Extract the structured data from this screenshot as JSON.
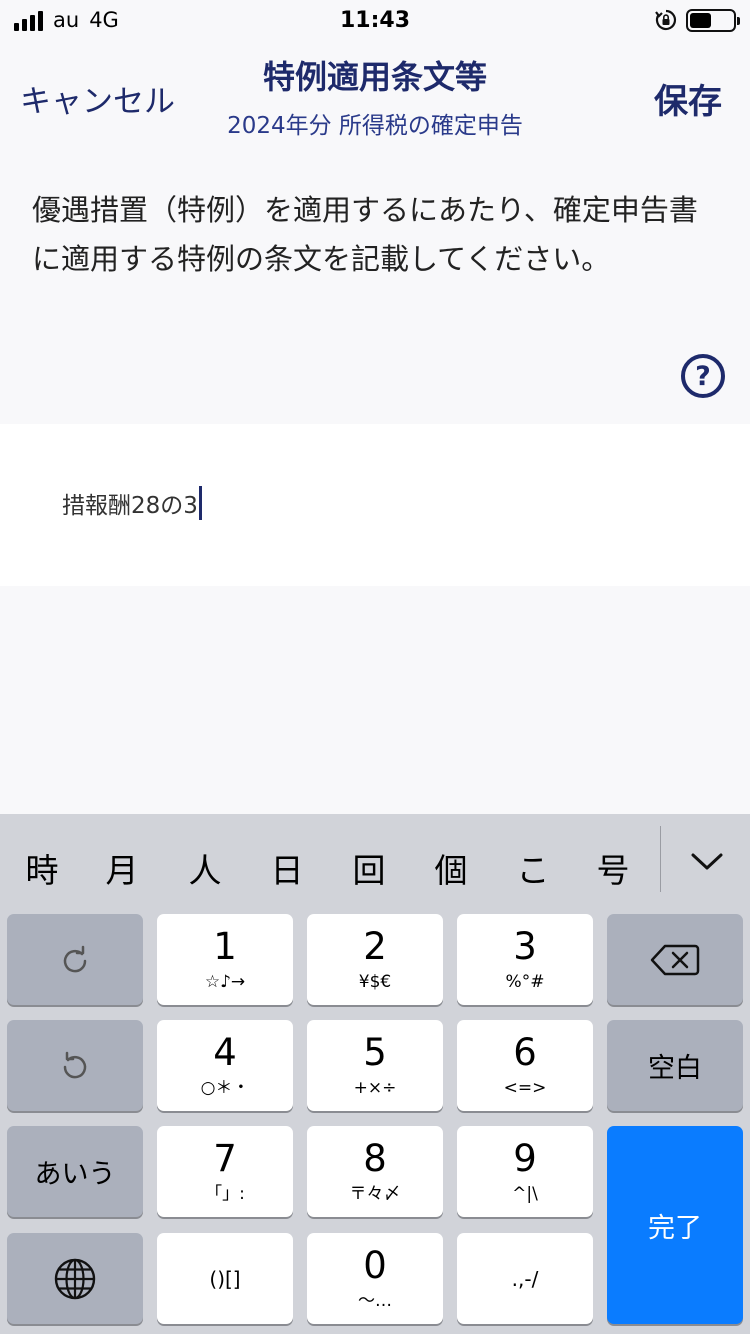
{
  "status_bar": {
    "carrier": "au",
    "network": "4G",
    "time": "11:43",
    "battery_level": 0.45
  },
  "nav": {
    "cancel": "キャンセル",
    "title": "特例適用条文等",
    "subtitle": "2024年分 所得税の確定申告",
    "save": "保存"
  },
  "description": "優遇措置（特例）を適用するにあたり、確定申告書に適用する特例の条文を記載してください。",
  "help_icon": "question-circle-icon",
  "input": {
    "value": "措報酬28の3"
  },
  "keyboard": {
    "candidates": [
      "時",
      "月",
      "人",
      "日",
      "回",
      "個",
      "こ",
      "号"
    ],
    "keys": {
      "k1": {
        "main": "1",
        "sub": "☆♪→"
      },
      "k2": {
        "main": "2",
        "sub": "¥$€"
      },
      "k3": {
        "main": "3",
        "sub": "%°#"
      },
      "k4": {
        "main": "4",
        "sub": "○＊・"
      },
      "k5": {
        "main": "5",
        "sub": "+×÷"
      },
      "k6": {
        "main": "6",
        "sub": "<=>"
      },
      "k7": {
        "main": "7",
        "sub": "「」:"
      },
      "k8": {
        "main": "8",
        "sub": "〒々〆"
      },
      "k9": {
        "main": "9",
        "sub": "^|\\"
      },
      "k0": {
        "main": "0",
        "sub": "〜…"
      },
      "brackets": "()[]",
      "punct": ".,-/",
      "space": "空白",
      "kana": "あいう",
      "done": "完了"
    },
    "accent_color": "#0a7cff"
  }
}
